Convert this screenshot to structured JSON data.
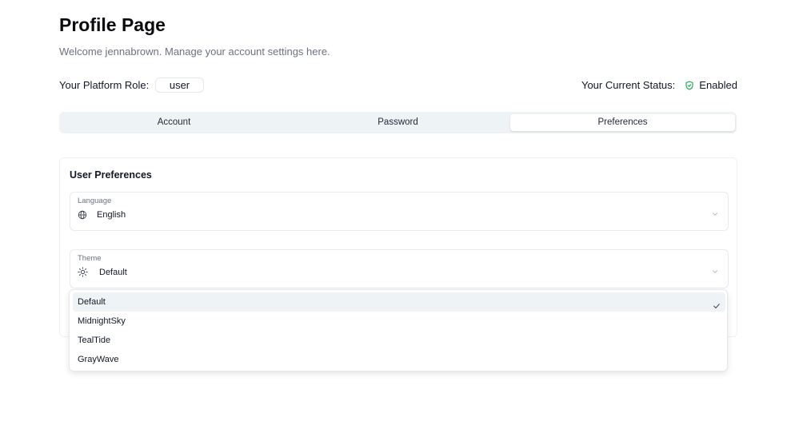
{
  "header": {
    "title": "Profile Page",
    "subtitle": "Welcome jennabrown. Manage your account settings here."
  },
  "role": {
    "label": "Your Platform Role:",
    "value": "user"
  },
  "status": {
    "label": "Your Current Status:",
    "value": "Enabled",
    "icon": "shield-check-icon",
    "color": "#16a34a"
  },
  "tabs": [
    {
      "label": "Account"
    },
    {
      "label": "Password"
    },
    {
      "label": "Preferences",
      "active": true
    }
  ],
  "preferences": {
    "title": "User Preferences",
    "language": {
      "label": "Language",
      "value": "English",
      "icon": "globe-icon"
    },
    "theme": {
      "label": "Theme",
      "value": "Default",
      "icon": "sun-icon",
      "options": [
        {
          "label": "Default",
          "selected": true
        },
        {
          "label": "MidnightSky"
        },
        {
          "label": "TealTide"
        },
        {
          "label": "GrayWave"
        }
      ]
    }
  }
}
